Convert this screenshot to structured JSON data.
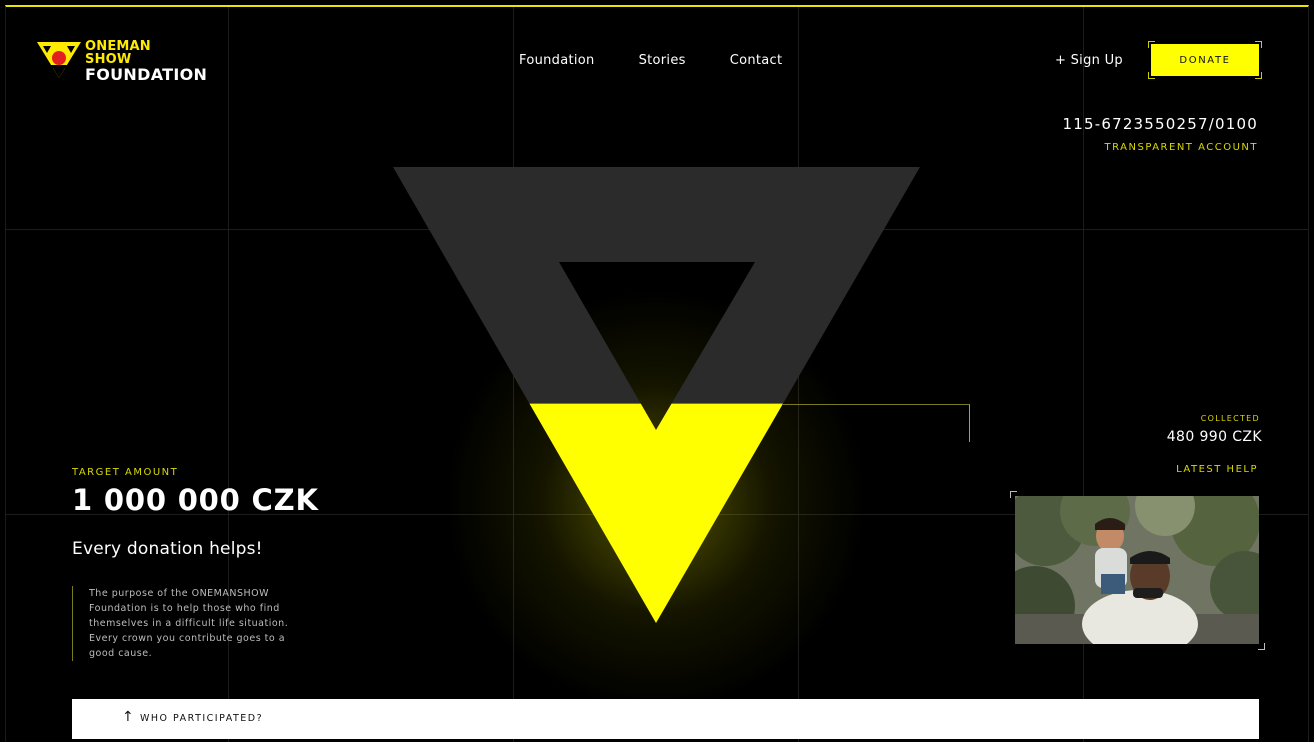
{
  "brand": {
    "line1": "ONEMAN",
    "line2": "SHOW",
    "line3": "FOUNDATION",
    "accent_color": "#ffff00",
    "background_color": "#000000"
  },
  "nav": {
    "items": [
      {
        "label": "Foundation"
      },
      {
        "label": "Stories"
      },
      {
        "label": "Contact"
      }
    ]
  },
  "header": {
    "signup_label": "+ Sign Up",
    "donate_label": "DONATE"
  },
  "account": {
    "number": "115-6723550257/0100",
    "label": "TRANSPARENT ACCOUNT"
  },
  "fundraising": {
    "collected_label": "COLLECTED",
    "collected_value": "480 990 CZK",
    "target_label": "TARGET AMOUNT",
    "target_value": "1 000 000 CZK",
    "tagline": "Every donation helps!",
    "description": "The purpose of the ONEMANSHOW Foundation is to help those who find themselves in a difficult life situation. Every crown you contribute goes to a good cause.",
    "progress_fraction": 0.481
  },
  "latest_help": {
    "label": "LATEST HELP",
    "image_icon": "photo-father-child"
  },
  "footer_bar": {
    "arrow_icon": "arrow-up-icon",
    "label": "WHO PARTICIPATED?"
  }
}
